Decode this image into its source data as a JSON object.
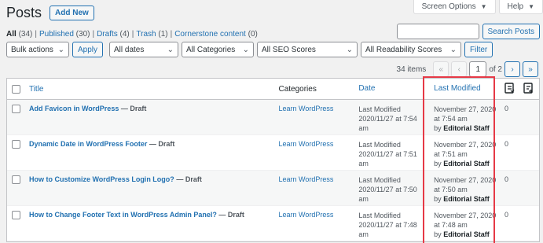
{
  "header": {
    "title": "Posts",
    "add_new": "Add New"
  },
  "screen_meta": {
    "screen_options": "Screen Options",
    "help": "Help"
  },
  "views": [
    {
      "label": "All",
      "count": "(34)"
    },
    {
      "label": "Published",
      "count": "(30)"
    },
    {
      "label": "Drafts",
      "count": "(4)"
    },
    {
      "label": "Trash",
      "count": "(1)"
    },
    {
      "label": "Cornerstone content",
      "count": "(0)"
    }
  ],
  "search": {
    "button": "Search Posts",
    "value": ""
  },
  "filters": {
    "bulk_actions": "Bulk actions",
    "apply": "Apply",
    "dates": "All dates",
    "categories": "All Categories",
    "seo": "All SEO Scores",
    "readability": "All Readability Scores",
    "filter": "Filter"
  },
  "pagination": {
    "items": "34 items",
    "first": "«",
    "prev": "‹",
    "current": "1",
    "of": "of 2",
    "next": "›",
    "last": "»"
  },
  "columns": {
    "title": "Title",
    "categories": "Categories",
    "date": "Date",
    "last_modified": "Last Modified"
  },
  "rows": [
    {
      "title": "Add Favicon in WordPress",
      "state": " — Draft",
      "category": "Learn WordPress",
      "date1": "Last Modified",
      "date2": "2020/11/27 at 7:54",
      "date3": "am",
      "lm1": "November 27, 2020",
      "lm2": "at 7:54 am",
      "lm_by": "by ",
      "lm_author": "Editorial Staff",
      "count": "0"
    },
    {
      "title": "Dynamic Date in WordPress Footer",
      "state": " — Draft",
      "category": "Learn WordPress",
      "date1": "Last Modified",
      "date2": "2020/11/27 at 7:51",
      "date3": "am",
      "lm1": "November 27, 2020",
      "lm2": "at 7:51 am",
      "lm_by": "by ",
      "lm_author": "Editorial Staff",
      "count": "0"
    },
    {
      "title": "How to Customize WordPress Login Logo?",
      "state": " — Draft",
      "category": "Learn WordPress",
      "date1": "Last Modified",
      "date2": "2020/11/27 at 7:50",
      "date3": "am",
      "lm1": "November 27, 2020",
      "lm2": "at 7:50 am",
      "lm_by": "by ",
      "lm_author": "Editorial Staff",
      "count": "0"
    },
    {
      "title": "How to Change Footer Text in WordPress Admin Panel?",
      "state": " — Draft",
      "category": "Learn WordPress",
      "date1": "Last Modified",
      "date2": "2020/11/27 at 7:48",
      "date3": "am",
      "lm1": "November 27, 2020",
      "lm2": "at 7:48 am",
      "lm_by": "by ",
      "lm_author": "Editorial Staff",
      "count": "0"
    }
  ],
  "colors": {
    "accent": "#2271b1",
    "highlight": "#e63946"
  }
}
